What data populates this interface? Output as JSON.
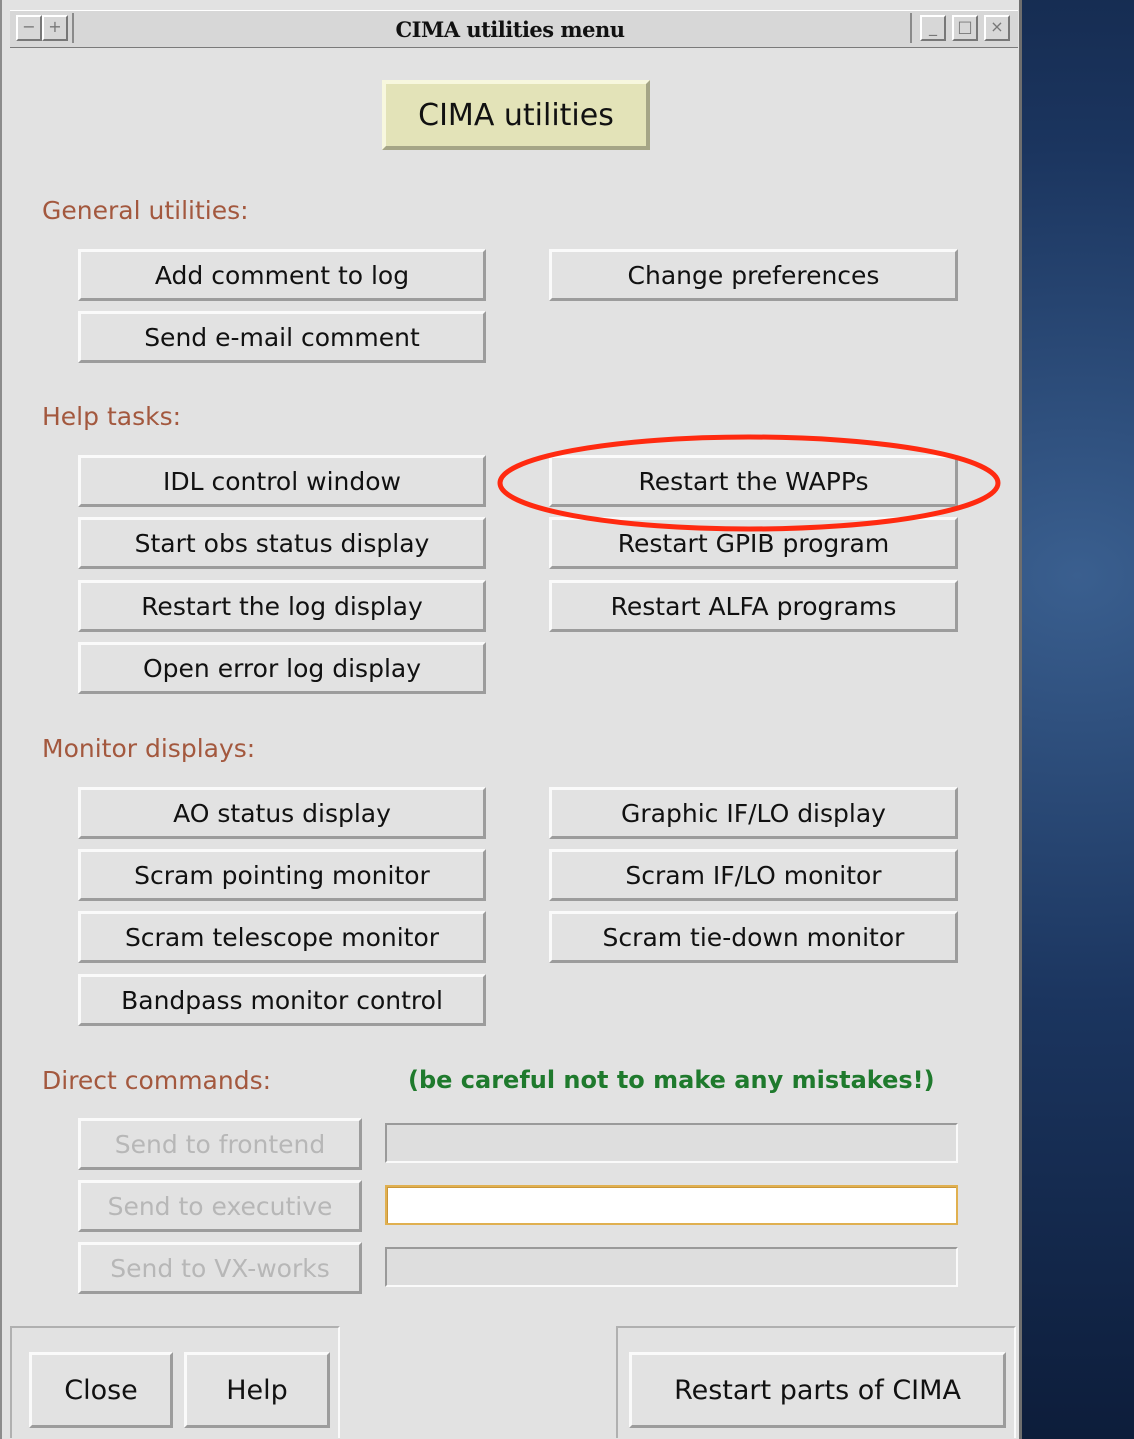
{
  "window": {
    "title": "CIMA utilities menu"
  },
  "banner": "CIMA utilities",
  "sections": {
    "general": {
      "label": "General utilities:",
      "buttons": [
        "Add comment to log",
        "Send e-mail comment",
        "Change preferences"
      ]
    },
    "help": {
      "label": "Help tasks:",
      "buttons": [
        "IDL control window",
        "Start obs status display",
        "Restart the log display",
        "Open error log display",
        "Restart the WAPPs",
        "Restart GPIB program",
        "Restart ALFA programs"
      ]
    },
    "monitor": {
      "label": "Monitor displays:",
      "buttons": [
        "AO status display",
        "Scram pointing monitor",
        "Scram telescope monitor",
        "Bandpass monitor control",
        "Graphic IF/LO display",
        "Scram IF/LO monitor",
        "Scram tie-down monitor"
      ]
    },
    "direct": {
      "label": "Direct commands:",
      "warning": "(be careful not to make any mistakes!)",
      "commands": [
        {
          "label": "Send to frontend",
          "value": ""
        },
        {
          "label": "Send to executive",
          "value": ""
        },
        {
          "label": "Send to VX-works",
          "value": ""
        }
      ]
    }
  },
  "footer": {
    "close": "Close",
    "help": "Help",
    "restart": "Restart parts of CIMA"
  },
  "annotation": {
    "color": "#ff2a10",
    "target": "Restart the WAPPs"
  },
  "colors": {
    "section_label": "#a3583e",
    "warning": "#1f7a2d",
    "banner_bg": "#e3e3b8",
    "window_bg": "#e2e2e2"
  }
}
